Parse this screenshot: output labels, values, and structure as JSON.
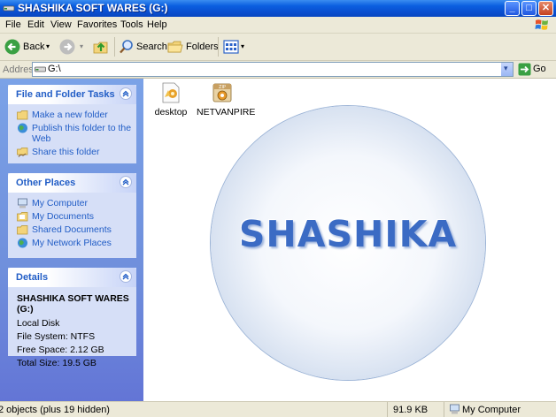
{
  "window": {
    "title": "SHASHIKA SOFT WARES (G:)",
    "min_glyph": "_",
    "max_glyph": "□",
    "close_glyph": "✕"
  },
  "menu": [
    "File",
    "Edit",
    "View",
    "Favorites",
    "Tools",
    "Help"
  ],
  "toolbar": {
    "back_label": "Back",
    "search_label": "Search",
    "folders_label": "Folders"
  },
  "address": {
    "label": "Address",
    "value": "G:\\",
    "go_label": "Go"
  },
  "taskpane": {
    "file_tasks": {
      "title": "File and Folder Tasks",
      "items": [
        "Make a new folder",
        "Publish this folder to the Web",
        "Share this folder"
      ]
    },
    "other_places": {
      "title": "Other Places",
      "items": [
        "My Computer",
        "My Documents",
        "Shared Documents",
        "My Network Places"
      ]
    },
    "details": {
      "title": "Details",
      "name": "SHASHIKA SOFT WARES (G:)",
      "type": "Local Disk",
      "file_system": "File System: NTFS",
      "free_space": "Free Space: 2.12 GB",
      "total_size": "Total Size: 19.5 GB"
    }
  },
  "content": {
    "files": [
      {
        "name": "desktop",
        "icon": "desktop-ini-icon"
      },
      {
        "name": "NETVANPIRE",
        "icon": "archive-icon"
      }
    ],
    "background_text": "SHASHIKA"
  },
  "statusbar": {
    "objects": "2 objects (plus 19 hidden)",
    "size": "91.9 KB",
    "location": "My Computer"
  },
  "colors": {
    "title_bar": "#0b5fe0",
    "task_pane": "#6f8fdc",
    "link": "#215dc6"
  }
}
